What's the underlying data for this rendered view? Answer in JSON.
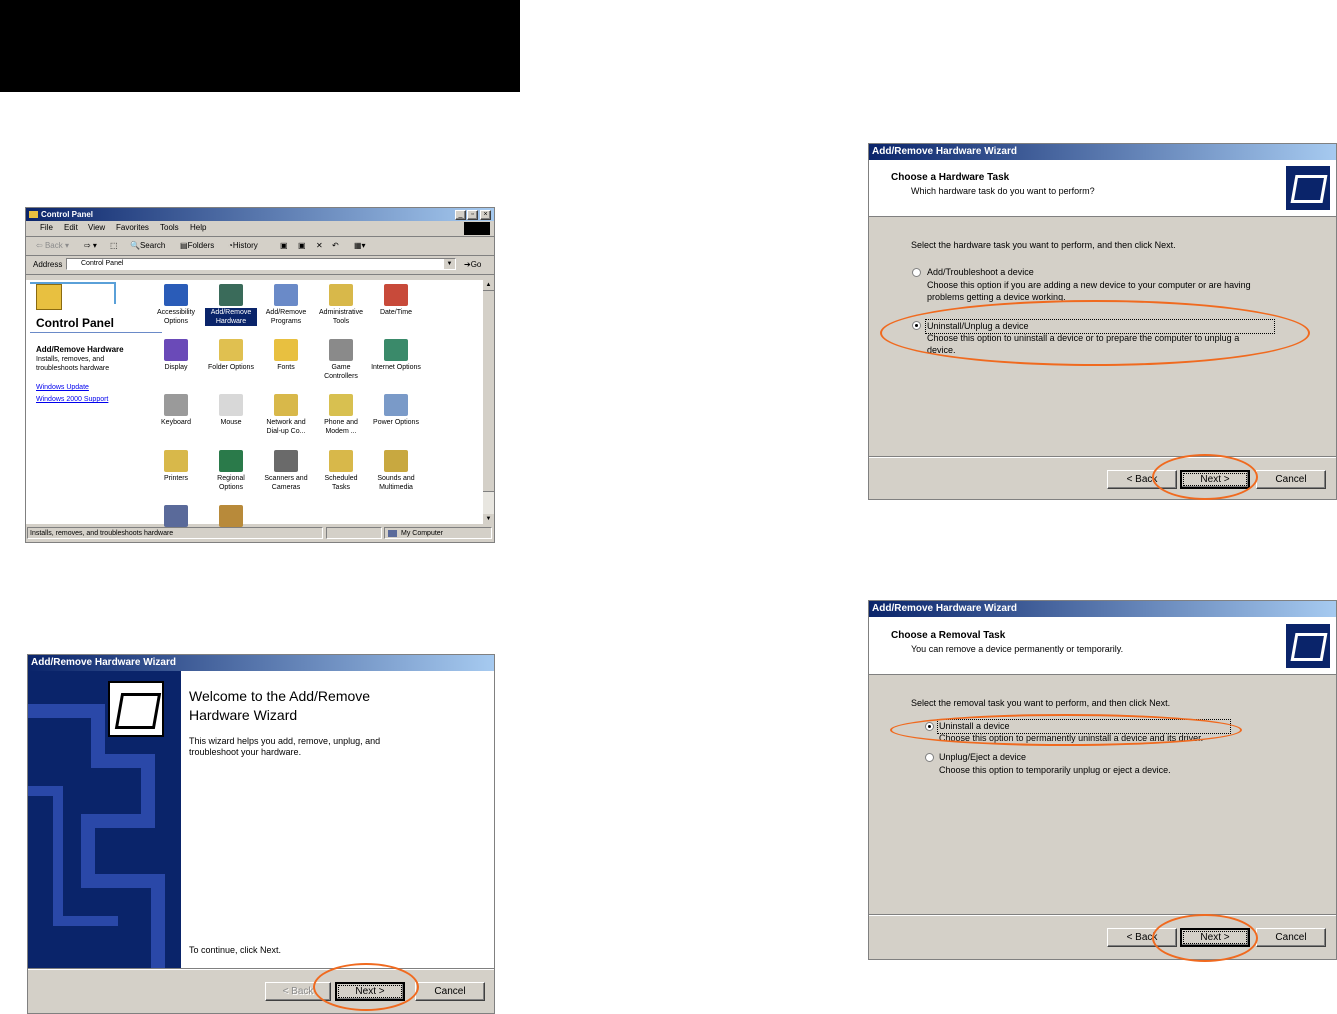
{
  "colors": {
    "title_blue": "#0a246a",
    "highlight": "#f06a1f"
  },
  "control_panel": {
    "title": "Control Panel",
    "menu": [
      "File",
      "Edit",
      "View",
      "Favorites",
      "Tools",
      "Help"
    ],
    "toolbar": {
      "back": "Back",
      "search": "Search",
      "folders": "Folders",
      "history": "History"
    },
    "address_label": "Address",
    "address_value": "Control Panel",
    "go": "Go",
    "left_title": "Control Panel",
    "selected_name": "Add/Remove Hardware",
    "selected_desc": "Installs, removes, and troubleshoots hardware",
    "links": [
      "Windows Update",
      "Windows 2000 Support"
    ],
    "icons": [
      {
        "label": "Accessibility Options",
        "icon": "accessibility-icon",
        "color": "#2a5cb8"
      },
      {
        "label": "Add/Remove Hardware",
        "icon": "hardware-icon",
        "color": "#3a6b5a"
      },
      {
        "label": "Add/Remove Programs",
        "icon": "programs-icon",
        "color": "#6a8ac8"
      },
      {
        "label": "Administrative Tools",
        "icon": "admin-tools-icon",
        "color": "#d8b84a"
      },
      {
        "label": "Date/Time",
        "icon": "clock-icon",
        "color": "#c84a3a"
      },
      {
        "label": "Display",
        "icon": "display-icon",
        "color": "#6a4ab8"
      },
      {
        "label": "Folder Options",
        "icon": "folder-options-icon",
        "color": "#e0c050"
      },
      {
        "label": "Fonts",
        "icon": "fonts-icon",
        "color": "#e8c040"
      },
      {
        "label": "Game Controllers",
        "icon": "joystick-icon",
        "color": "#8a8a8a"
      },
      {
        "label": "Internet Options",
        "icon": "globe-icon",
        "color": "#3a8a6a"
      },
      {
        "label": "Keyboard",
        "icon": "keyboard-icon",
        "color": "#9a9a9a"
      },
      {
        "label": "Mouse",
        "icon": "mouse-icon",
        "color": "#d8d8d8"
      },
      {
        "label": "Network and Dial-up Co...",
        "icon": "network-icon",
        "color": "#d8b84a"
      },
      {
        "label": "Phone and Modem ...",
        "icon": "phone-icon",
        "color": "#d8c050"
      },
      {
        "label": "Power Options",
        "icon": "power-icon",
        "color": "#7a9ac8"
      },
      {
        "label": "Printers",
        "icon": "printer-icon",
        "color": "#d8b84a"
      },
      {
        "label": "Regional Options",
        "icon": "globe-icon",
        "color": "#2a7a4a"
      },
      {
        "label": "Scanners and Cameras",
        "icon": "scanner-icon",
        "color": "#6a6a6a"
      },
      {
        "label": "Scheduled Tasks",
        "icon": "tasks-icon",
        "color": "#d8b84a"
      },
      {
        "label": "Sounds and Multimedia",
        "icon": "speaker-icon",
        "color": "#c8a840"
      },
      {
        "label": "",
        "icon": "computer-icon",
        "color": "#5a6a9a"
      },
      {
        "label": "",
        "icon": "users-icon",
        "color": "#b88a3a"
      }
    ],
    "status_left": "Installs, removes, and troubleshoots hardware",
    "status_right": "My Computer"
  },
  "wizard_welcome": {
    "title": "Add/Remove Hardware Wizard",
    "heading": "Welcome to the Add/Remove Hardware Wizard",
    "body": "This wizard helps you add, remove, unplug, and troubleshoot your hardware.",
    "footer": "To continue, click Next.",
    "back": "< Back",
    "next": "Next >",
    "cancel": "Cancel"
  },
  "wizard_task": {
    "title": "Add/Remove Hardware Wizard",
    "h1": "Choose a Hardware Task",
    "h2": "Which hardware task do you want to perform?",
    "instruction": "Select the hardware task you want to perform, and then click Next.",
    "options": [
      {
        "label": "Add/Troubleshoot a device",
        "desc1": "Choose this option if you are adding a new device to your computer or are having",
        "desc2": "problems getting a device working.",
        "selected": false
      },
      {
        "label": "Uninstall/Unplug a device",
        "desc1": "Choose this option to uninstall a device or to prepare the computer to unplug a",
        "desc2": "device.",
        "selected": true
      }
    ],
    "back": "< Back",
    "next": "Next >",
    "cancel": "Cancel"
  },
  "wizard_removal": {
    "title": "Add/Remove Hardware Wizard",
    "h1": "Choose a Removal Task",
    "h2": "You can remove a device permanently or temporarily.",
    "instruction": "Select the removal task you want to perform, and then click Next.",
    "options": [
      {
        "label": "Uninstall a device",
        "desc1": "Choose this option to permanently uninstall a device and its driver.",
        "selected": true
      },
      {
        "label": "Unplug/Eject a device",
        "desc1": "Choose this option to temporarily unplug or eject a device.",
        "selected": false
      }
    ],
    "back": "< Back",
    "next": "Next >",
    "cancel": "Cancel"
  }
}
